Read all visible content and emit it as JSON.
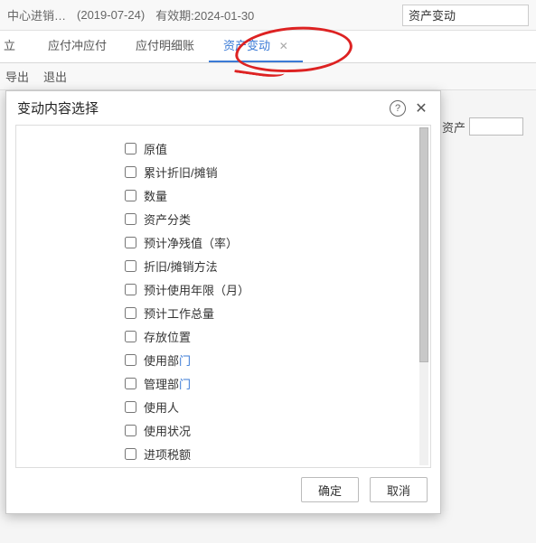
{
  "topbar": {
    "breadcrumb": "中心进销…",
    "date": "(2019-07-24)",
    "validity": "有效期:2024-01-30",
    "search_value": "资产变动"
  },
  "tabs": {
    "t0": "立",
    "t1": "应付冲应付",
    "t2": "应付明细账",
    "t3": "资产变动"
  },
  "subbar": {
    "export": "导出",
    "exit": "退出"
  },
  "filter": {
    "asset_label": "资产"
  },
  "modal": {
    "title": "变动内容选择",
    "ok": "确定",
    "cancel": "取消",
    "items": [
      "原值",
      "累计折旧/摊销",
      "数量",
      "资产分类",
      "预计净残值（率）",
      "折旧/摊销方法",
      "预计使用年限（月）",
      "预计工作总量",
      "存放位置",
      "使用部门",
      "管理部门",
      "使用人",
      "使用状况",
      "进项税额"
    ]
  }
}
